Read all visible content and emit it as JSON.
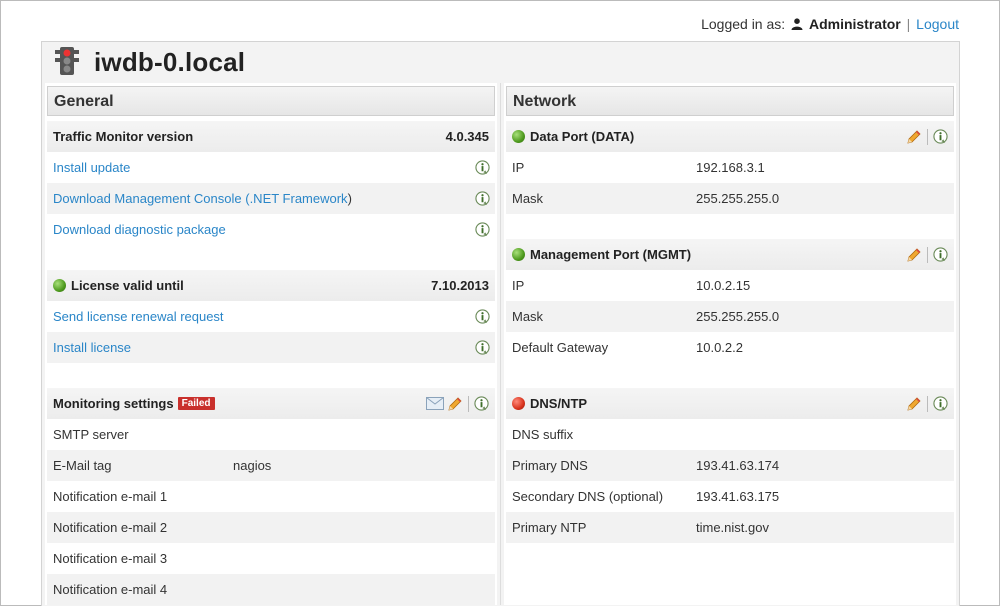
{
  "header": {
    "logged_in_label": "Logged in as:",
    "username": "Administrator",
    "separator": "|",
    "logout_label": "Logout"
  },
  "page": {
    "title": "iwdb-0.local"
  },
  "general": {
    "title": "General",
    "version_label": "Traffic Monitor version",
    "version_value": "4.0.345",
    "install_update": "Install update",
    "download_console": "Download Management Console (",
    "net_framework": ".NET Framework",
    "download_console_close": ")",
    "download_diag": "Download diagnostic package",
    "license_label": "License valid until",
    "license_value": "7.10.2013",
    "license_status": "green",
    "send_renewal": "Send license renewal request",
    "install_license": "Install license",
    "monitoring_label": "Monitoring settings",
    "monitoring_badge": "Failed",
    "smtp_label": "SMTP server",
    "smtp_value": "",
    "email_tag_label": "E-Mail tag",
    "email_tag_value": "nagios",
    "notif1_label": "Notification e-mail 1",
    "notif2_label": "Notification e-mail 2",
    "notif3_label": "Notification e-mail 3",
    "notif4_label": "Notification e-mail 4"
  },
  "network": {
    "title": "Network",
    "data_port": {
      "label": "Data Port (DATA)",
      "status": "green",
      "ip_label": "IP",
      "ip_value": "192.168.3.1",
      "mask_label": "Mask",
      "mask_value": "255.255.255.0"
    },
    "mgmt_port": {
      "label": "Management Port (MGMT)",
      "status": "green",
      "ip_label": "IP",
      "ip_value": "10.0.2.15",
      "mask_label": "Mask",
      "mask_value": "255.255.255.0",
      "gw_label": "Default Gateway",
      "gw_value": "10.0.2.2"
    },
    "dns": {
      "label": "DNS/NTP",
      "status": "red",
      "suffix_label": "DNS suffix",
      "suffix_value": "",
      "pdns_label": "Primary DNS",
      "pdns_value": "193.41.63.174",
      "sdns_label": "Secondary DNS (optional)",
      "sdns_value": "193.41.63.175",
      "ntp_label": "Primary NTP",
      "ntp_value": "time.nist.gov"
    }
  },
  "icons": {
    "user": "user-icon",
    "traffic_light": "traffic-light-icon",
    "info": "info-icon",
    "edit": "pencil-icon",
    "mail": "envelope-icon",
    "status_ok": "green-status-icon",
    "status_err": "red-status-icon"
  },
  "colors": {
    "link": "#2a86c8",
    "badge": "#c9302c",
    "ok": "#4e9a1e",
    "error": "#d8321c"
  }
}
